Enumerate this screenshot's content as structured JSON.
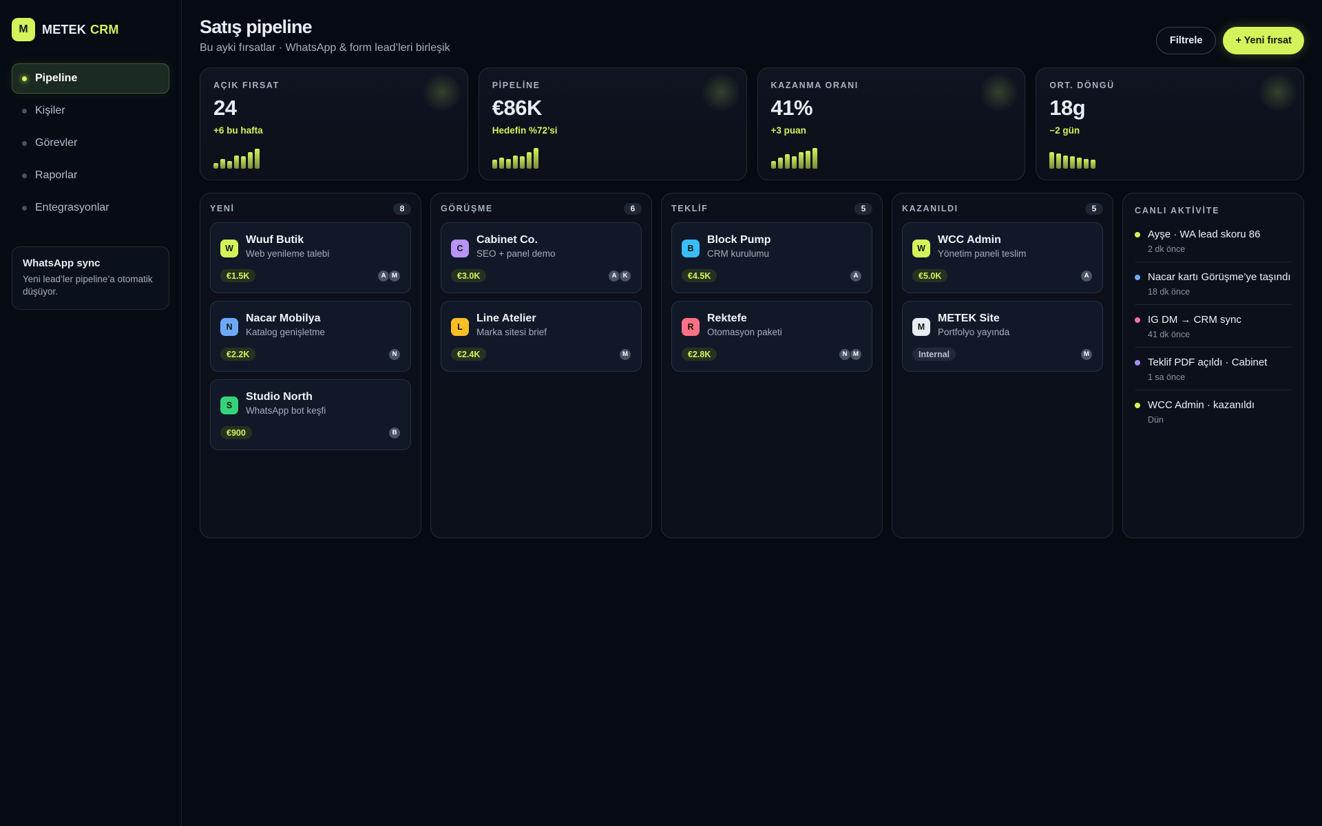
{
  "brand": {
    "badge": "M",
    "name": "METEK",
    "accent": "CRM",
    "accent_color": "#d4f25a"
  },
  "sidebar": {
    "items": [
      {
        "label": "Pipeline",
        "active": true
      },
      {
        "label": "Kişiler",
        "active": false
      },
      {
        "label": "Görevler",
        "active": false
      },
      {
        "label": "Raporlar",
        "active": false
      },
      {
        "label": "Entegrasyonlar",
        "active": false
      }
    ],
    "sync": {
      "title": "WhatsApp sync",
      "text": "Yeni lead’ler pipeline’a otomatik düşüyor."
    }
  },
  "header": {
    "title": "Satış pipeline",
    "subtitle": "Bu ayki fırsatlar · WhatsApp & form lead’leri birleşik",
    "filter_label": "Filtrele",
    "new_label": "+ Yeni fırsat"
  },
  "kpis": [
    {
      "label": "AÇIK FIRSAT",
      "value": "24",
      "delta": "+6 bu hafta",
      "spark": [
        0.25,
        0.45,
        0.35,
        0.6,
        0.55,
        0.75,
        0.9
      ]
    },
    {
      "label": "PİPELİNE",
      "value": "€86K",
      "delta": "Hedefin %72’si",
      "spark": [
        0.4,
        0.5,
        0.45,
        0.6,
        0.55,
        0.75,
        0.95
      ]
    },
    {
      "label": "KAZANMA ORANI",
      "value": "41%",
      "delta": "+3 puan",
      "spark": [
        0.35,
        0.5,
        0.65,
        0.55,
        0.75,
        0.8,
        0.95
      ]
    },
    {
      "label": "ORT. DÖNGÜ",
      "value": "18g",
      "delta": "−2 gün",
      "spark": [
        0.75,
        0.7,
        0.6,
        0.55,
        0.5,
        0.45,
        0.4
      ]
    }
  ],
  "columns": [
    {
      "title": "YENİ",
      "count": "8",
      "deals": [
        {
          "initial": "W",
          "color": "#d4f25a",
          "name": "Wuuf Butik",
          "desc": "Web yenileme talebi",
          "amount": "€1.5K",
          "internal": false,
          "avatars": [
            "A",
            "M"
          ]
        },
        {
          "initial": "N",
          "color": "#6ea8fe",
          "name": "Nacar Mobilya",
          "desc": "Katalog genişletme",
          "amount": "€2.2K",
          "internal": false,
          "avatars": [
            "N"
          ]
        },
        {
          "initial": "S",
          "color": "#34d37a",
          "name": "Studio North",
          "desc": "WhatsApp bot keşfi",
          "amount": "€900",
          "internal": false,
          "avatars": [
            "B"
          ]
        }
      ]
    },
    {
      "title": "GÖRÜŞME",
      "count": "6",
      "deals": [
        {
          "initial": "C",
          "color": "#b794f6",
          "name": "Cabinet Co.",
          "desc": "SEO + panel demo",
          "amount": "€3.0K",
          "internal": false,
          "avatars": [
            "A",
            "K"
          ]
        },
        {
          "initial": "L",
          "color": "#fbbf24",
          "name": "Line Atelier",
          "desc": "Marka sitesi brief",
          "amount": "€2.4K",
          "internal": false,
          "avatars": [
            "M"
          ]
        }
      ]
    },
    {
      "title": "TEKLİF",
      "count": "5",
      "deals": [
        {
          "initial": "B",
          "color": "#38bdf8",
          "name": "Block Pump",
          "desc": "CRM kurulumu",
          "amount": "€4.5K",
          "internal": false,
          "avatars": [
            "A"
          ]
        },
        {
          "initial": "R",
          "color": "#fb7185",
          "name": "Rektefe",
          "desc": "Otomasyon paketi",
          "amount": "€2.8K",
          "internal": false,
          "avatars": [
            "N",
            "M"
          ]
        }
      ]
    },
    {
      "title": "KAZANILDI",
      "count": "5",
      "deals": [
        {
          "initial": "W",
          "color": "#d4f25a",
          "name": "WCC Admin",
          "desc": "Yönetim paneli teslim",
          "amount": "€5.0K",
          "internal": false,
          "avatars": [
            "A"
          ]
        },
        {
          "initial": "M",
          "color": "#e8ecf4",
          "name": "METEK Site",
          "desc": "Portfolyo yayında",
          "amount": "Internal",
          "internal": true,
          "avatars": [
            "M"
          ]
        }
      ]
    }
  ],
  "activity": {
    "title": "CANLI AKTİVİTE",
    "items": [
      {
        "text": "Ayşe · WA lead skoru 86",
        "time": "2 dk önce",
        "color": "#d4f25a"
      },
      {
        "text": "Nacar kartı Görüşme’ye taşındı",
        "time": "18 dk önce",
        "color": "#6ea8fe"
      },
      {
        "text": "IG DM → CRM sync",
        "time": "41 dk önce",
        "color": "#f472b6"
      },
      {
        "text": "Teklif PDF açıldı · Cabinet",
        "time": "1 sa önce",
        "color": "#a78bfa"
      },
      {
        "text": "WCC Admin · kazanıldı",
        "time": "Dün",
        "color": "#d4f25a"
      }
    ]
  }
}
